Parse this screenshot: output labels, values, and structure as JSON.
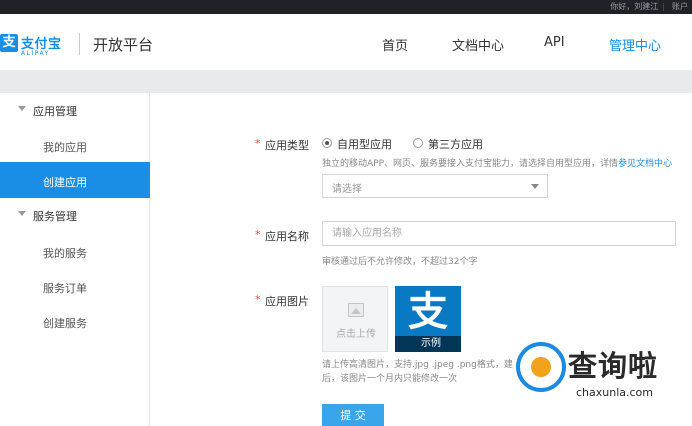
{
  "topbar": {
    "greeting": "你好，刘建江",
    "account": "账户"
  },
  "header": {
    "logo_mark": "支",
    "logo_text": "支付宝",
    "logo_sub": "ALIPAY",
    "platform_title": "开放平台",
    "nav": [
      {
        "label": "首页",
        "active": false
      },
      {
        "label": "文档中心",
        "active": false
      },
      {
        "label": "API",
        "active": false
      },
      {
        "label": "管理中心",
        "active": true
      }
    ],
    "accent_color": "#1a8ee6"
  },
  "sidebar": {
    "group_app": "应用管理",
    "item_my_apps": "我的应用",
    "item_create_app": "创建应用",
    "group_service": "服务管理",
    "item_my_services": "我的服务",
    "item_service_orders": "服务订单",
    "item_create_service": "创建服务",
    "active_item": "创建应用"
  },
  "form": {
    "required_mark": "*",
    "type_label": "应用类型",
    "type_option_self": "自用型应用",
    "type_option_third": "第三方应用",
    "type_selected": "自用型应用",
    "type_help": "独立的移动APP、网页、服务要接入支付宝能力，请选择自用型应用，详情",
    "type_help_link": "参见文档中心",
    "select_placeholder": "请选择",
    "name_label": "应用名称",
    "name_placeholder": "请输入应用名称",
    "name_value": "",
    "name_help": "审核通过后不允许修改，不超过32个字",
    "image_label": "应用图片",
    "upload_label": "点击上传",
    "example_glyph": "支",
    "example_caption": "示例",
    "image_help_1": "请上传高清图片，支持.jpg .jpeg .png格式，建",
    "image_help_2": "后，该图片一个月内只能修改一次",
    "submit_label": "提 交"
  },
  "watermark": {
    "title": "查询啦",
    "url": "chaxunla.com"
  }
}
